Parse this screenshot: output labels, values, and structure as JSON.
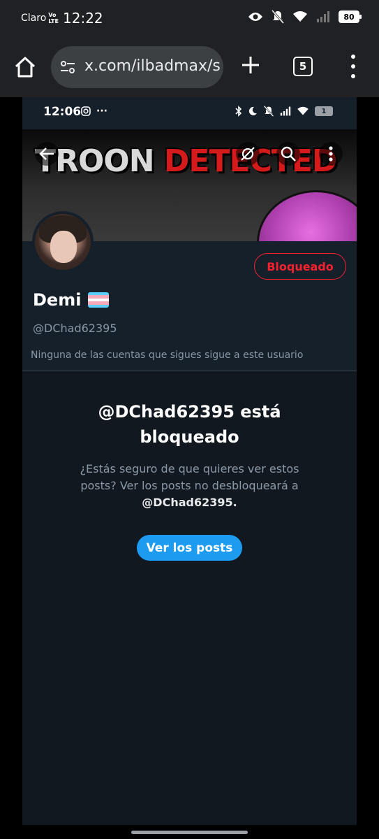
{
  "os_status": {
    "carrier": "Claro",
    "volte_top": "Vo",
    "volte_bottom": "LTE",
    "time": "12:22",
    "battery": "80"
  },
  "browser": {
    "url": "x.com/ilbadmax/s",
    "tab_count": "5"
  },
  "inner_status": {
    "time": "12:06",
    "dots": "···",
    "battery": "1"
  },
  "banner": {
    "word1": "TROON",
    "word2": "DETECTED"
  },
  "profile": {
    "display_name": "Demi",
    "handle": "@DChad62395",
    "blocked_label": "Bloqueado",
    "follow_info": "Ninguna de las cuentas que sigues sigue a este usuario",
    "flag_colors": [
      "#5bcefa",
      "#f5a9b8",
      "#ffffff",
      "#f5a9b8",
      "#5bcefa"
    ]
  },
  "blocked": {
    "title_line1": "@DChad62395 está",
    "title_line2": "bloqueado",
    "desc_part1": "¿Estás seguro de que quieres ver estos posts? Ver los posts no desbloqueará a",
    "desc_handle": "@DChad62395.",
    "view_button": "Ver los posts"
  },
  "colors": {
    "accent_blue": "#1d9bf0",
    "blocked_red": "#f4212e",
    "bg": "#15202b"
  }
}
